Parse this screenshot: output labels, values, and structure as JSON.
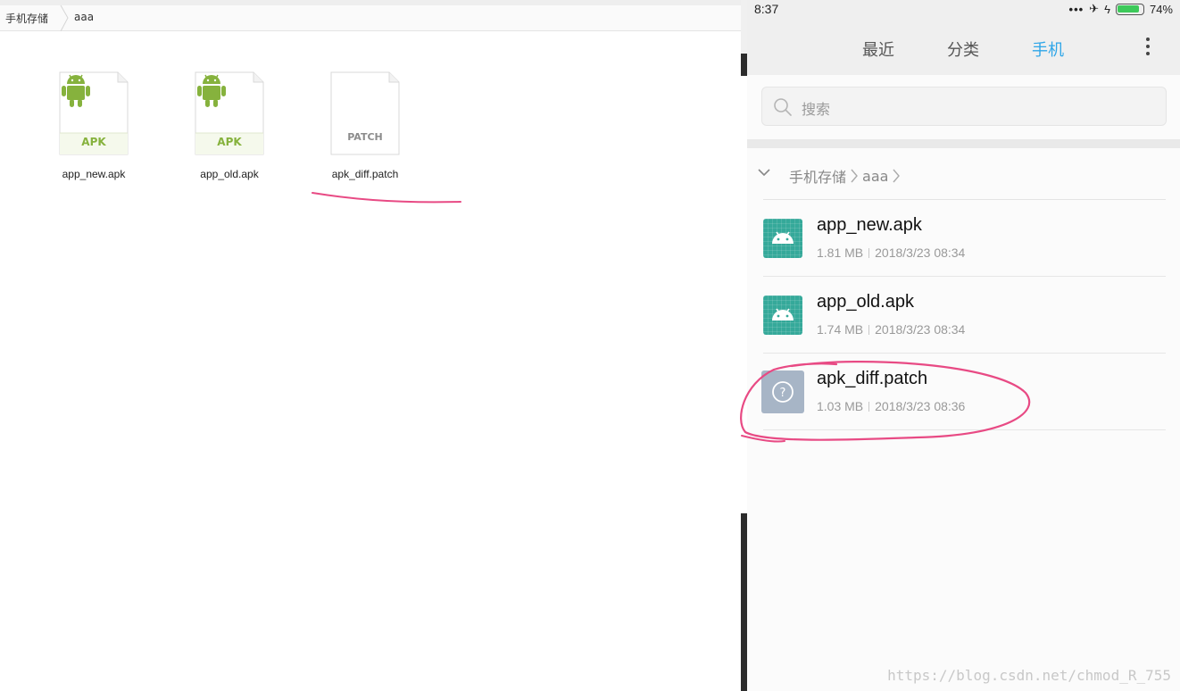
{
  "desktop": {
    "breadcrumb": [
      "手机存储",
      "aaa"
    ],
    "files": [
      {
        "name": "app_new.apk",
        "badge": "APK",
        "kind": "apk"
      },
      {
        "name": "app_old.apk",
        "badge": "APK",
        "kind": "apk"
      },
      {
        "name": "apk_diff.patch",
        "badge": "PATCH",
        "kind": "patch"
      }
    ],
    "annotation_color": "#e84a84"
  },
  "phone": {
    "status": {
      "time": "8:37",
      "battery": "74%",
      "icons": [
        "more-dots-icon",
        "airplane-icon",
        "charging-icon",
        "battery-icon"
      ]
    },
    "tabs": [
      {
        "label": "最近",
        "active": false
      },
      {
        "label": "分类",
        "active": false
      },
      {
        "label": "手机",
        "active": true
      }
    ],
    "accent_color": "#2fa6e8",
    "search": {
      "placeholder": "搜索"
    },
    "path": {
      "parts": [
        "手机存储",
        "aaa"
      ]
    },
    "files": [
      {
        "name": "app_new.apk",
        "size": "1.81 MB",
        "date": "2018/3/23 08:34",
        "icon": "android-icon"
      },
      {
        "name": "app_old.apk",
        "size": "1.74 MB",
        "date": "2018/3/23 08:34",
        "icon": "android-icon"
      },
      {
        "name": "apk_diff.patch",
        "size": "1.03 MB",
        "date": "2018/3/23 08:36",
        "icon": "unknown-file-icon"
      }
    ]
  },
  "watermark": "https://blog.csdn.net/chmod_R_755"
}
